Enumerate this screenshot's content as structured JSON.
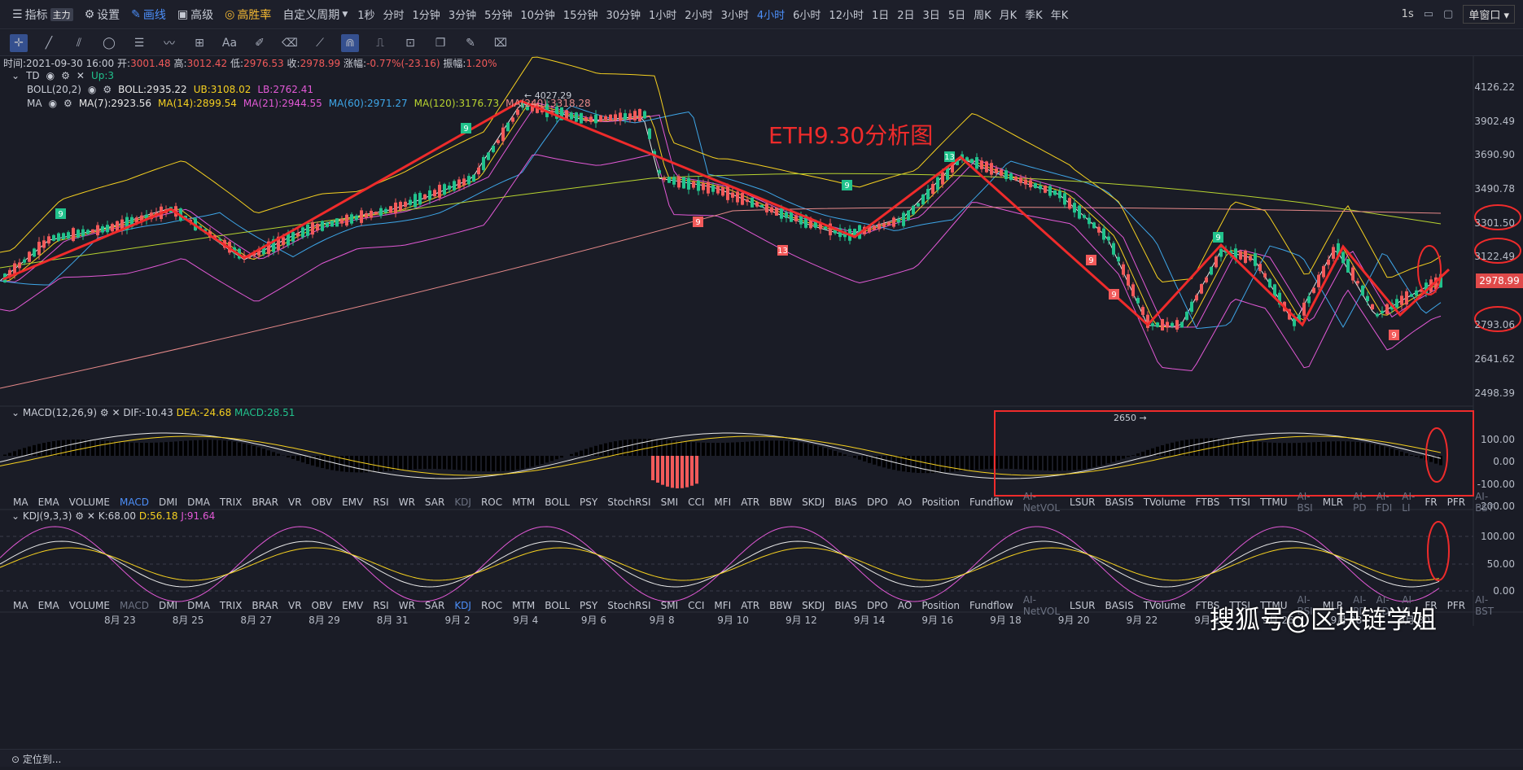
{
  "toolbar": {
    "indicator_label": "指标",
    "indicator_badge": "主力",
    "settings_label": "设置",
    "draw_label": "画线",
    "advanced_label": "高级",
    "winrate_label": "高胜率",
    "custom_period_label": "自定义周期",
    "periods": [
      "1秒",
      "分时",
      "1分钟",
      "3分钟",
      "5分钟",
      "10分钟",
      "15分钟",
      "30分钟",
      "1小时",
      "2小时",
      "3小时",
      "4小时",
      "6小时",
      "12小时",
      "1日",
      "2日",
      "3日",
      "5日",
      "周K",
      "月K",
      "季K",
      "年K"
    ],
    "active_period": "4小时",
    "right_refresh": "1s",
    "window_mode": "单窗口"
  },
  "drawing_tools": [
    "crosshair-icon",
    "line-icon",
    "parallel-icon",
    "circle-icon",
    "fib-icon",
    "wave-icon",
    "measure-icon",
    "text-icon",
    "brush-icon",
    "eraser-icon",
    "ruler-icon",
    "magnet-icon",
    "pattern-icon",
    "lock-icon",
    "copy-icon",
    "edit-icon",
    "trash-icon"
  ],
  "info": {
    "time": "时间:2021-09-30 16:00",
    "open_label": "开:",
    "open": "3001.48",
    "high_label": "高:",
    "high": "3012.42",
    "low_label": "低:",
    "low": "2976.53",
    "close_label": "收:",
    "close": "2978.99",
    "change_label": "涨幅:",
    "change": "-0.77%(-23.16)",
    "amp_label": "振幅:",
    "amp": "1.20%"
  },
  "legend": {
    "td_name": "TD",
    "td_value": "Up:3",
    "boll_name": "BOLL(20,2)",
    "boll": "BOLL:2935.22",
    "ub": "UB:3108.02",
    "lb": "LB:2762.41",
    "ma_name": "MA",
    "ma7": "MA(7):2923.56",
    "ma14": "MA(14):2899.54",
    "ma21": "MA(21):2944.55",
    "ma60": "MA(60):2971.27",
    "ma120": "MA(120):3176.73",
    "ma240": "MA(240):3318.28"
  },
  "annotation_title": "ETH9.30分析图",
  "high_marker": "← 4027.29",
  "low_marker": "2650 →",
  "price_axis": [
    "4126.22",
    "3902.49",
    "3690.90",
    "3490.78",
    "3301.50",
    "3122.49",
    "2793.06",
    "2641.62",
    "2498.39"
  ],
  "current_price": "2978.99",
  "td_labels": [
    "9",
    "9",
    "13",
    "9",
    "9",
    "9",
    "13",
    "9",
    "9",
    "9",
    "9",
    "9"
  ],
  "macd": {
    "name": "MACD(12,26,9)",
    "dif": "DIF:-10.43",
    "dea": "DEA:-24.68",
    "macd": "MACD:28.51",
    "axis": [
      "100.00",
      "0.00",
      "-100.00",
      "-200.00"
    ]
  },
  "kdj": {
    "name": "KDJ(9,3,3)",
    "k": "K:68.00",
    "d": "D:56.18",
    "j": "J:91.64",
    "axis": [
      "100.00",
      "50.00",
      "0.00"
    ]
  },
  "indicator_list": [
    "MA",
    "EMA",
    "VOLUME",
    "MACD",
    "DMI",
    "DMA",
    "TRIX",
    "BRAR",
    "VR",
    "OBV",
    "EMV",
    "RSI",
    "WR",
    "SAR",
    "KDJ",
    "ROC",
    "MTM",
    "BOLL",
    "PSY",
    "StochRSI",
    "SMI",
    "CCI",
    "MFI",
    "ATR",
    "BBW",
    "SKDJ",
    "BIAS",
    "DPO",
    "AO",
    "Position",
    "Fundflow",
    "AI-NetVOL",
    "LSUR",
    "BASIS",
    "TVolume",
    "FTBS",
    "TTSI",
    "TTMU",
    "AI-BSI",
    "MLR",
    "AI-PD",
    "AI-FDI",
    "AI-LI",
    "FR",
    "PFR",
    "AI-BST"
  ],
  "dates": [
    "8月 23",
    "8月 25",
    "8月 27",
    "8月 29",
    "8月 31",
    "9月 2",
    "9月 4",
    "9月 6",
    "9月 8",
    "9月 10",
    "9月 12",
    "9月 14",
    "9月 16",
    "9月 18",
    "9月 20",
    "9月 22",
    "9月 24",
    "9月 26",
    "9月 28",
    "9月 30"
  ],
  "watermark": "搜狐号@区块链学姐",
  "bottom_label": "定位到...",
  "colors": {
    "up": "#21c28c",
    "down": "#f25a5a",
    "annotation": "#ef2b2b",
    "active": "#4c8ef7"
  }
}
